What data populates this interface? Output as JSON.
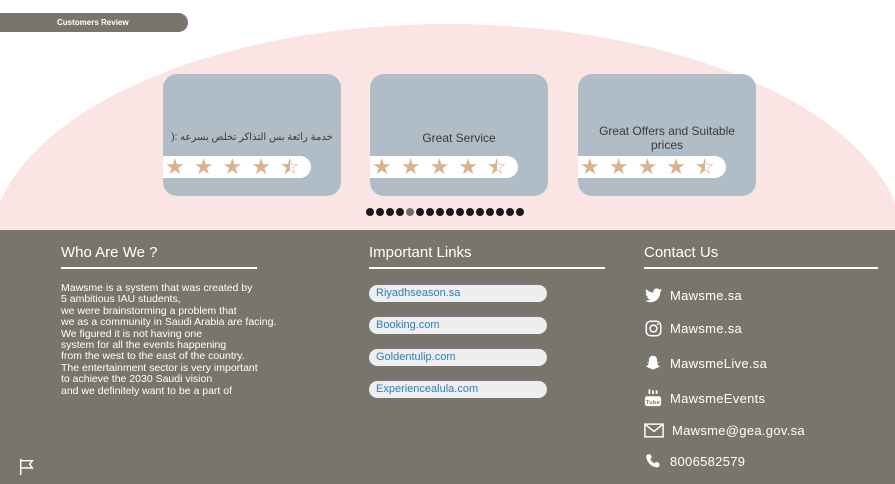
{
  "review_section": {
    "tab_label": "Customers Review",
    "reviews": [
      {
        "text": "خدمة رائعة بس التذاكر تخلص بسرعه :(",
        "rating": 4.5
      },
      {
        "text": "Great Service",
        "rating": 4.5
      },
      {
        "text": "Great Offers and Suitable prices",
        "rating": 4.5
      }
    ],
    "carousel": {
      "dot_count": 16,
      "active_index": 4
    }
  },
  "footer": {
    "about": {
      "title": "Who Are We ?",
      "text": "Mawsme is a system that was created by\n5 ambitious IAU students,\nwe were brainstorming a problem that\nwe as a community in Saudi Arabia are facing.\nWe figured it is not having one\nsystem for all the events happening\nfrom the west to the east of the country.\nThe entertainment sector is very important\nto achieve the 2030 Saudi vision\nand we definitely want to be a part of"
    },
    "links": {
      "title": "Important Links",
      "items": [
        "Riyadhseason.sa",
        "Booking.com",
        "Goldentulip.com",
        "Experiencealula.com"
      ]
    },
    "contact": {
      "title": "Contact Us",
      "items": [
        {
          "icon": "twitter-icon",
          "label": "Mawsme.sa"
        },
        {
          "icon": "instagram-icon",
          "label": "Mawsme.sa"
        },
        {
          "icon": "snapchat-icon",
          "label": "MawsmeLive.sa"
        },
        {
          "icon": "youtube-icon",
          "label": "MawsmeEvents"
        },
        {
          "icon": "mail-icon",
          "label": "Mawsme@gea.gov.sa"
        },
        {
          "icon": "phone-icon",
          "label": "8006582579"
        }
      ]
    }
  },
  "colors": {
    "footer_bg": "#78766c",
    "card_bg": "#b0bcc6",
    "arc_bg": "#fbe4e4",
    "star": "#d9b38c",
    "link_text": "#2f7fb5"
  }
}
